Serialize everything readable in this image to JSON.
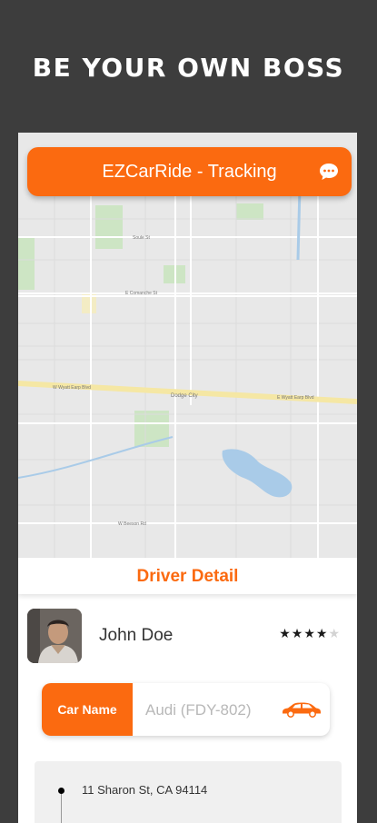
{
  "promo": {
    "title": "BE YOUR OWN BOSS"
  },
  "header": {
    "title": "EZCarRide - Tracking",
    "action_icon": "chat-bubble-icon"
  },
  "map": {
    "labels": [
      "Soule St",
      "E Comanche St",
      "W Wyatt Earp Blvd",
      "Dodge City",
      "E Wyatt Earp Blvd",
      "W Beeson Rd"
    ]
  },
  "driver_detail": {
    "title": "Driver Detail",
    "name": "John Doe",
    "rating": 4,
    "rating_max": 5
  },
  "car": {
    "label": "Car Name",
    "value": "Audi (FDY-802)",
    "icon": "car-icon"
  },
  "route": {
    "pickup_address": "11 Sharon St, CA 94114"
  },
  "colors": {
    "accent": "#fb6a10",
    "background": "#3d3d3d",
    "map_background": "#e8e8e8"
  }
}
